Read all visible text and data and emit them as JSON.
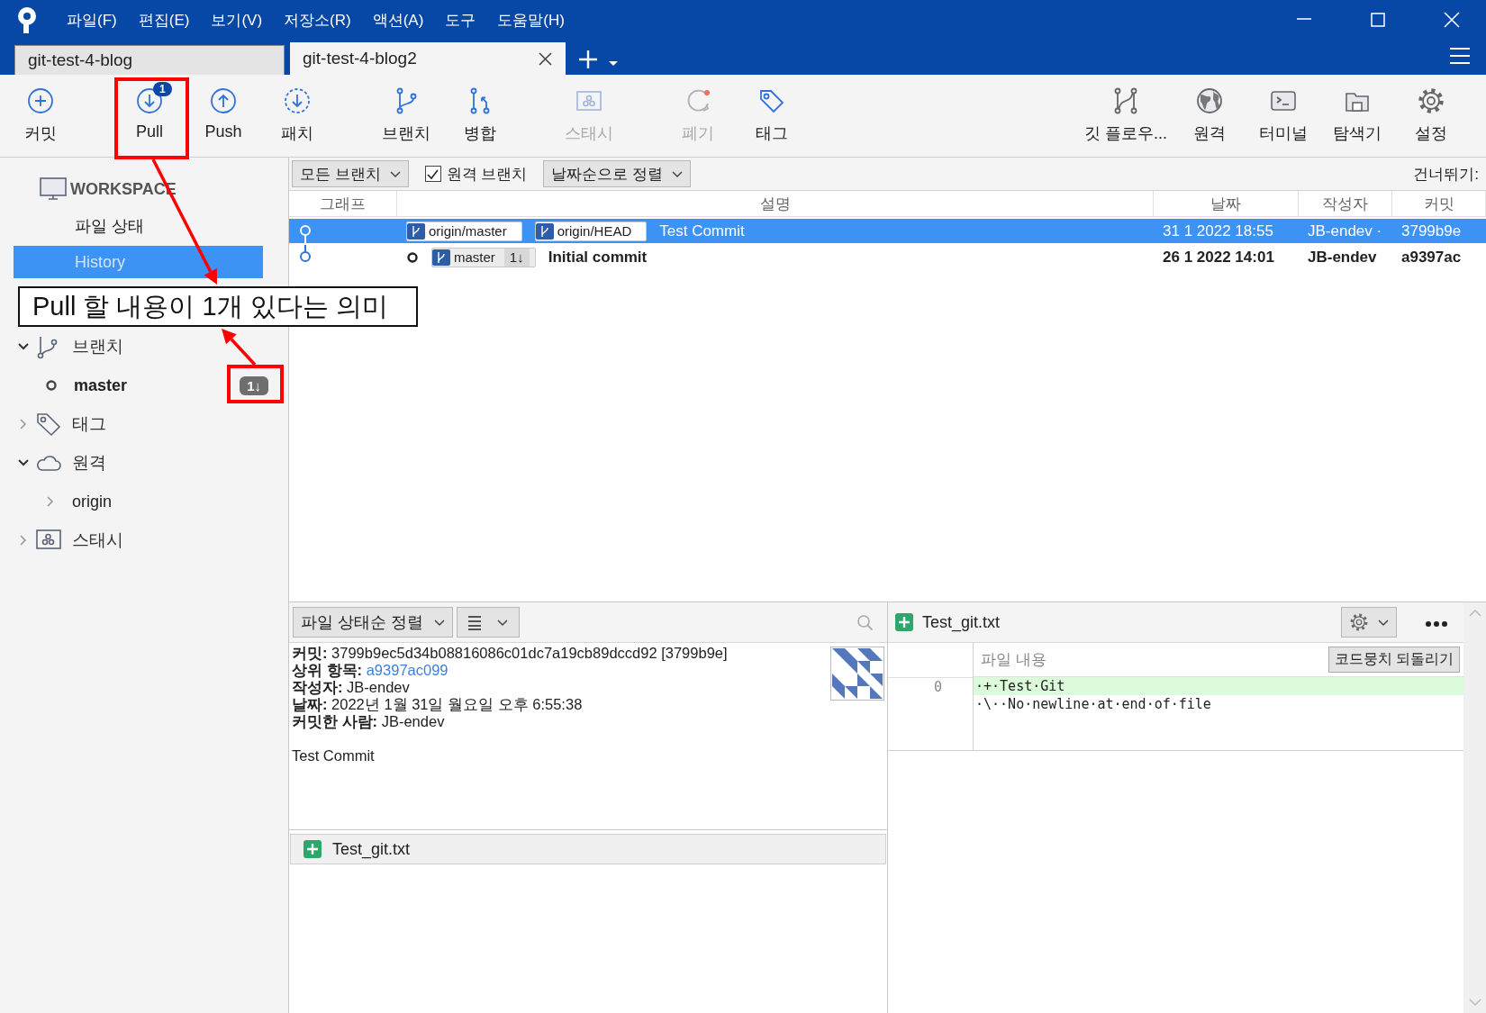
{
  "menu": [
    {
      "label": "파일(F)"
    },
    {
      "label": "편집(E)"
    },
    {
      "label": "보기(V)"
    },
    {
      "label": "저장소(R)"
    },
    {
      "label": "액션(A)"
    },
    {
      "label": "도구"
    },
    {
      "label": "도움말(H)"
    }
  ],
  "tabs": [
    {
      "label": "git-test-4-blog",
      "selected": false
    },
    {
      "label": "git-test-4-blog2",
      "selected": true
    }
  ],
  "toolbar": {
    "left": [
      {
        "kind": "commit",
        "label": "커밋",
        "disabled": false
      },
      {
        "kind": "pull",
        "label": "Pull",
        "disabled": false,
        "badge": "1"
      },
      {
        "kind": "push",
        "label": "Push",
        "disabled": false
      },
      {
        "kind": "fetch",
        "label": "패치",
        "disabled": false
      },
      {
        "kind": "branch",
        "label": "브랜치",
        "disabled": false
      },
      {
        "kind": "merge",
        "label": "병합",
        "disabled": false
      },
      {
        "kind": "stash",
        "label": "스태시",
        "disabled": true
      },
      {
        "kind": "discard",
        "label": "폐기",
        "disabled": true
      },
      {
        "kind": "tag",
        "label": "태그",
        "disabled": false
      }
    ],
    "right": [
      {
        "kind": "gitflow",
        "label": "깃 플로우...",
        "disabled": false
      },
      {
        "kind": "remote",
        "label": "원격",
        "disabled": false
      },
      {
        "kind": "terminal",
        "label": "터미널",
        "disabled": false
      },
      {
        "kind": "explorer",
        "label": "탐색기",
        "disabled": false
      },
      {
        "kind": "settings",
        "label": "설정",
        "disabled": false
      }
    ]
  },
  "sidebar": {
    "workspace": {
      "title": "WORKSPACE",
      "items": [
        {
          "label": "파일 상태",
          "selected": false
        },
        {
          "label": "History",
          "selected": true
        }
      ]
    },
    "sections": [
      {
        "kind": "branch",
        "label": "브랜치",
        "expanded": true,
        "children": [
          {
            "label": "master",
            "current": true,
            "badge": "1↓"
          }
        ]
      },
      {
        "kind": "tag",
        "label": "태그",
        "expanded": false
      },
      {
        "kind": "remote",
        "label": "원격",
        "expanded": true,
        "children": [
          {
            "label": "origin",
            "current": false,
            "expanded": false
          }
        ]
      },
      {
        "kind": "stash",
        "label": "스태시",
        "expanded": false
      }
    ]
  },
  "history": {
    "branch_filter": "모든 브랜치",
    "remote_branches": {
      "label": "원격 브랜치",
      "checked": true
    },
    "sort": "날짜순으로 정렬",
    "jump_label": "건너뛰기:",
    "columns": [
      "그래프",
      "설명",
      "날짜",
      "작성자",
      "커밋"
    ],
    "rows": [
      {
        "selected": true,
        "head": false,
        "refs": [
          {
            "label": "origin/master"
          },
          {
            "label": "origin/HEAD"
          }
        ],
        "description": "Test Commit",
        "date": "31 1 2022 18:55",
        "author": "JB-endev ·",
        "commit": "3799b9e"
      },
      {
        "selected": false,
        "head": true,
        "refs": [
          {
            "label": "master",
            "badge": "1↓"
          }
        ],
        "description": "Initial commit",
        "date": "26 1 2022 14:01",
        "author": "JB-endev",
        "commit": "a9397ac"
      }
    ]
  },
  "details": {
    "sort": "파일 상태순 정렬",
    "fields": [
      {
        "label": "커밋:",
        "value": "3799b9ec5d34b08816086c01dc7a19cb89dccd92 [3799b9e]",
        "link": false
      },
      {
        "label": "상위 항목:",
        "value": "a9397ac099",
        "link": true
      },
      {
        "label": "작성자:",
        "value": "JB-endev",
        "link": false
      },
      {
        "label": "날짜:",
        "value": "2022년 1월 31일 월요일 오후 6:55:38",
        "link": false
      },
      {
        "label": "커밋한 사람:",
        "value": "JB-endev",
        "link": false
      }
    ],
    "message": "Test Commit",
    "files": [
      {
        "name": "Test_git.txt",
        "kind": "added"
      }
    ]
  },
  "diff": {
    "file": "Test_git.txt",
    "kind": "added",
    "header": "파일 내용",
    "revert_button": "코드뭉치 되돌리기",
    "lines": [
      {
        "number": "0",
        "text": "·+·Test·Git",
        "kind": "added"
      },
      {
        "text": "·\\··No·newline·at·end·of·file",
        "kind": "context"
      }
    ]
  },
  "annotation": {
    "callout": "Pull 할 내용이 1개 있다는 의미"
  }
}
